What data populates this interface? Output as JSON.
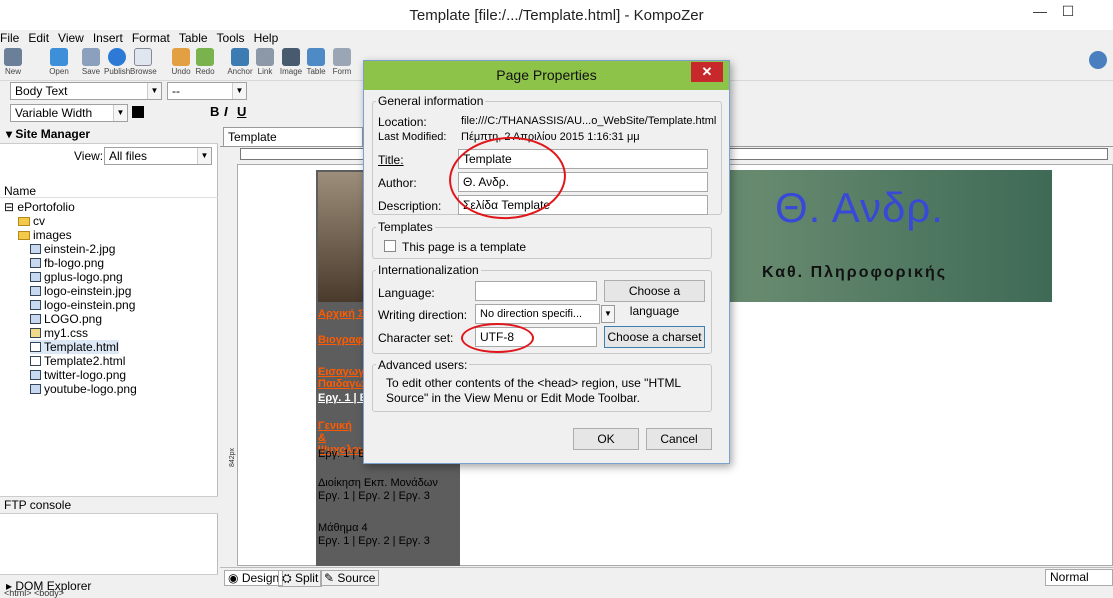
{
  "window": {
    "title": "Template [file:/.../Template.html] - KompoZer"
  },
  "menu": [
    "File",
    "Edit",
    "View",
    "Insert",
    "Format",
    "Table",
    "Tools",
    "Help"
  ],
  "toolbar": {
    "buttons": [
      "New",
      "Open",
      "Save",
      "Publish",
      "Browse",
      "Undo",
      "Redo",
      "Anchor",
      "Link",
      "Image",
      "Table",
      "Form"
    ]
  },
  "format_bar": {
    "style": "Body Text",
    "font": "--",
    "width": "Variable Width",
    "bold": "B",
    "italic": "I",
    "underline": "U"
  },
  "sidebar": {
    "title": "Site Manager",
    "view_label": "View:",
    "view_value": "All files",
    "name_header": "Name",
    "items": [
      {
        "label": "ePortofolio",
        "type": "folder"
      },
      {
        "label": "cv",
        "type": "folder"
      },
      {
        "label": "images",
        "type": "folder"
      },
      {
        "label": "einstein-2.jpg",
        "type": "file"
      },
      {
        "label": "fb-logo.png",
        "type": "file"
      },
      {
        "label": "gplus-logo.png",
        "type": "file"
      },
      {
        "label": "logo-einstein.jpg",
        "type": "file"
      },
      {
        "label": "logo-einstein.png",
        "type": "file"
      },
      {
        "label": "LOGO.png",
        "type": "file"
      },
      {
        "label": "my1.css",
        "type": "file"
      },
      {
        "label": "Template.html",
        "type": "file"
      },
      {
        "label": "Template2.html",
        "type": "file"
      },
      {
        "label": "twitter-logo.png",
        "type": "file"
      },
      {
        "label": "youtube-logo.png",
        "type": "file"
      }
    ],
    "ftp_console": "FTP console",
    "dom_explorer": "DOM Explorer"
  },
  "editor": {
    "tab": "Template",
    "ruler_label": "842px",
    "page": {
      "header_title": "Θ. Ανδρ.",
      "header_sub": "Καθ. Πληροφορικής",
      "nav": [
        {
          "title": "Αρχική Σ",
          "links": ""
        },
        {
          "title": "Βιογραφ",
          "links": ""
        },
        {
          "title": "Εισαγωγ Παιδαγω",
          "links": "Εργ. 1 | Ερ"
        },
        {
          "title": "Γενική & Ψυχολογ",
          "links": "Εργ. 1 | Ε"
        },
        {
          "title": "Διοίκηση Εκπ. Μονάδων",
          "links": "Εργ. 1 | Εργ. 2 | Εργ. 3"
        },
        {
          "title": "Μάθημα 4",
          "links": "Εργ. 1 | Εργ. 2 | Εργ. 3"
        }
      ]
    },
    "mode_tabs": [
      "Design",
      "Split",
      "Source"
    ],
    "zoom": "Normal",
    "status": "<html> <body>"
  },
  "dialog": {
    "title": "Page Properties",
    "general": {
      "legend": "General information",
      "location_label": "Location:",
      "location_value": "file:///C:/THANASSIS/AU...o_WebSite/Template.html",
      "modified_label": "Last Modified:",
      "modified_value": "Πέμπτη, 2 Απριλίου 2015 1:16:31 μμ",
      "title_label": "Title:",
      "title_value": "Template",
      "author_label": "Author:",
      "author_value": "Θ. Ανδρ.",
      "description_label": "Description:",
      "description_value": "Σελίδα Template"
    },
    "templates": {
      "legend": "Templates",
      "checkbox_label": "This page is a template"
    },
    "i18n": {
      "legend": "Internationalization",
      "language_label": "Language:",
      "language_value": "",
      "choose_language": "Choose a language",
      "direction_label": "Writing direction:",
      "direction_value": "No direction specifi...",
      "charset_label": "Character set:",
      "charset_value": "UTF-8",
      "choose_charset": "Choose a charset"
    },
    "advanced": {
      "legend": "Advanced users:",
      "text": "To edit other contents of the <head> region, use \"HTML Source\" in the View Menu or Edit Mode Toolbar."
    },
    "ok": "OK",
    "cancel": "Cancel",
    "highlight_color": "#e0161b",
    "title_bar_color": "#8ec349"
  }
}
